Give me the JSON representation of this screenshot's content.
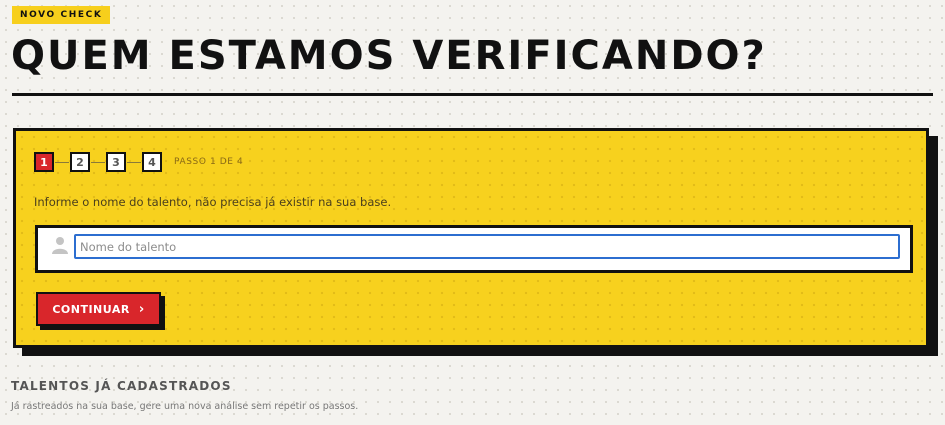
{
  "header": {
    "badge": "NOVO CHECK",
    "title": "QUEM ESTAMOS VERIFICANDO?"
  },
  "stepper": {
    "steps": [
      "1",
      "2",
      "3",
      "4"
    ],
    "active_step": 1,
    "progress_label": "PASSO 1 DE 4"
  },
  "form": {
    "instruction": "Informe o nome do talento, não precisa já existir na sua base.",
    "name_input": {
      "placeholder": "Nome do talento",
      "value": ""
    },
    "continue_label": "CONTINUAR",
    "continue_icon": "chevron-right-icon"
  },
  "registered": {
    "title": "TALENTOS JÁ CADASTRADOS",
    "subtitle": "Já rastreados na sua base, gere uma nova análise sem repetir os passos."
  },
  "colors": {
    "accent_yellow": "#f7d11e",
    "accent_red": "#d9262b",
    "ink": "#111111",
    "input_focus": "#2c6ed0"
  }
}
